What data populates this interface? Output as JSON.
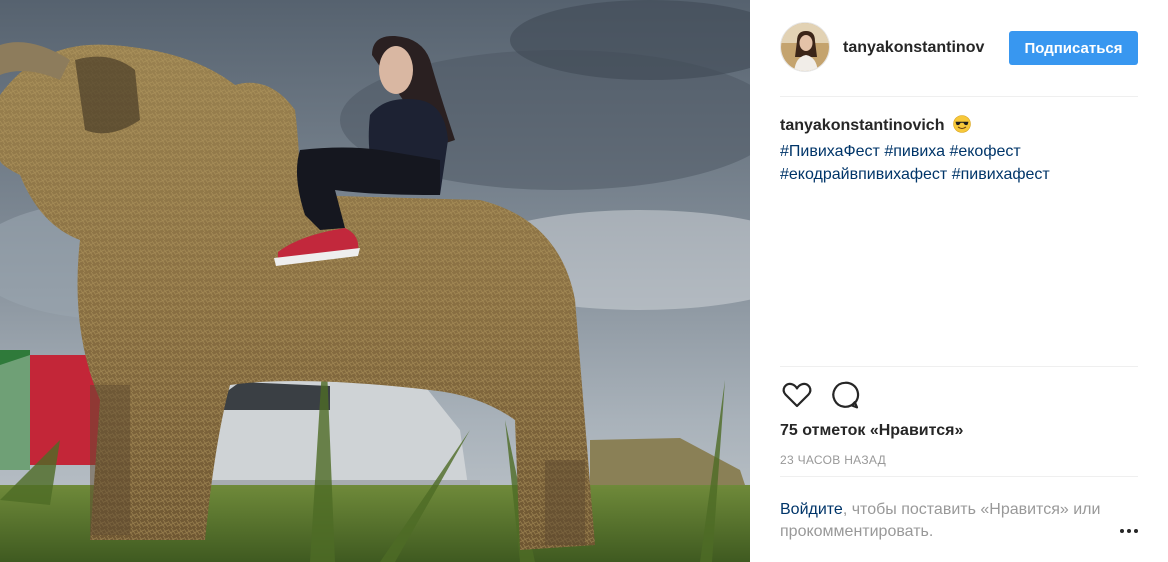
{
  "post": {
    "username": "tanyakonstantinov",
    "follow_label": "Подписаться",
    "caption_user": "tanyakonstantinovich",
    "hashtags": [
      "#ПивихаФест",
      "#пивиха",
      "#екофест",
      "#екодрайвпивихафест",
      "#пивихафест"
    ],
    "likes": "75 отметок «Нравится»",
    "time_ago": "23 ЧАСОВ НАЗАД",
    "login_link": "Войдите",
    "login_rest": ", чтобы поставить «Нравится» или прокомментировать."
  },
  "icons": {
    "like": "heart-outline-icon",
    "comment": "speech-bubble-icon",
    "more": "ellipsis-icon",
    "emoji": "sunglasses-smiley-emoji"
  },
  "colors": {
    "follow_button": "#3897f0",
    "link": "#003569",
    "muted": "#999999",
    "text": "#262626"
  }
}
